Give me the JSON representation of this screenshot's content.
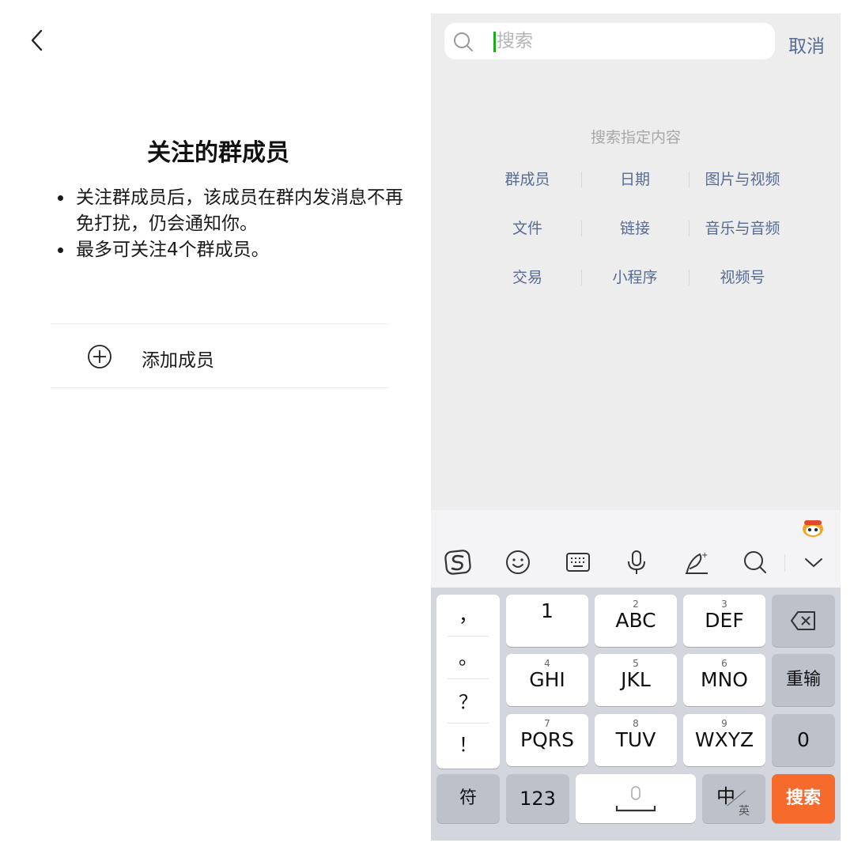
{
  "left_panel": {
    "title": "关注的群成员",
    "bullets": [
      "关注群成员后，该成员在群内发消息不再免打扰，仍会通知你。",
      "最多可关注4个群成员。"
    ],
    "add_member_label": "添加成员"
  },
  "search_panel": {
    "search_placeholder": "搜索",
    "cancel_label": "取消",
    "hint": "搜索指定内容",
    "categories": [
      "群成员",
      "日期",
      "图片与视频",
      "文件",
      "链接",
      "音乐与音频",
      "交易",
      "小程序",
      "视频号"
    ],
    "accent_color": "#576b95"
  },
  "keyboard": {
    "punctuation": [
      "，",
      "。",
      "？",
      "！"
    ],
    "keys": [
      {
        "main": "1",
        "sub": ""
      },
      {
        "main": "ABC",
        "sub": "2"
      },
      {
        "main": "DEF",
        "sub": "3"
      },
      {
        "main": "GHI",
        "sub": "4"
      },
      {
        "main": "JKL",
        "sub": "5"
      },
      {
        "main": "MNO",
        "sub": "6"
      },
      {
        "main": "PQRS",
        "sub": "7"
      },
      {
        "main": "TUV",
        "sub": "8"
      },
      {
        "main": "WXYZ",
        "sub": "9"
      }
    ],
    "retype_label": "重输",
    "zero_label": "0",
    "symbol_label": "符",
    "num_label": "123",
    "lang_main": "中",
    "lang_sub": "英",
    "search_label": "搜索",
    "search_color": "#f66b2b",
    "toolbar_icons": [
      "sogou-logo-icon",
      "emoji-icon",
      "keyboard-icon",
      "microphone-icon",
      "handwriting-icon",
      "search-icon",
      "collapse-chevron-icon"
    ]
  }
}
